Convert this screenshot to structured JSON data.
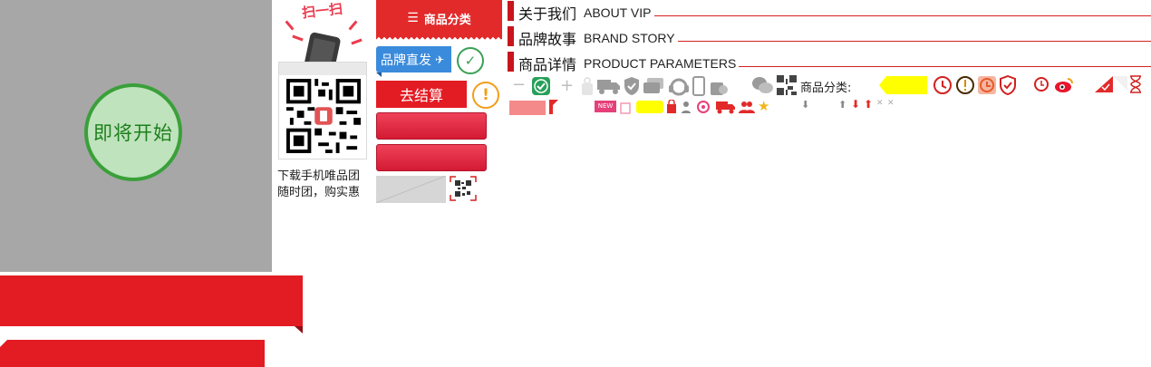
{
  "start_badge": {
    "label": "即将开始"
  },
  "qr": {
    "scan_label": "扫一扫",
    "caption_line1": "下载手机唯品团",
    "caption_line2": "随时团，购实惠"
  },
  "buttons": {
    "category_label": "商品分类",
    "brand_direct_label": "品牌直发",
    "checkout_label": "去结算"
  },
  "headings": [
    {
      "cn": "关于我们",
      "en": "ABOUT VIP"
    },
    {
      "cn": "品牌故事",
      "en": "BRAND STORY"
    },
    {
      "cn": "商品详情",
      "en": "PRODUCT  PARAMETERS"
    }
  ],
  "icon_strip": {
    "category_label": "商品分类:",
    "new_badge": "NEW"
  },
  "icons": [
    "minus-icon",
    "check-circle-icon",
    "plus-icon",
    "gift-icon",
    "truck-icon",
    "shield-icon",
    "cards-icon",
    "headset-icon",
    "phone-icon",
    "bag-icon",
    "wechat-icon",
    "qr-icon",
    "history-icon",
    "alert-icon",
    "clock-icon",
    "shield-red-icon",
    "clock-small-icon",
    "weibo-icon",
    "corner-check-icon",
    "hourglass-icon"
  ],
  "colors": {
    "brand_red": "#e31b23",
    "panel_gray": "#a7a7a7",
    "accent_green": "#3aa03a",
    "accent_blue": "#3b8bdc",
    "accent_orange": "#f29d1b",
    "highlight_yellow": "#ffff00"
  }
}
